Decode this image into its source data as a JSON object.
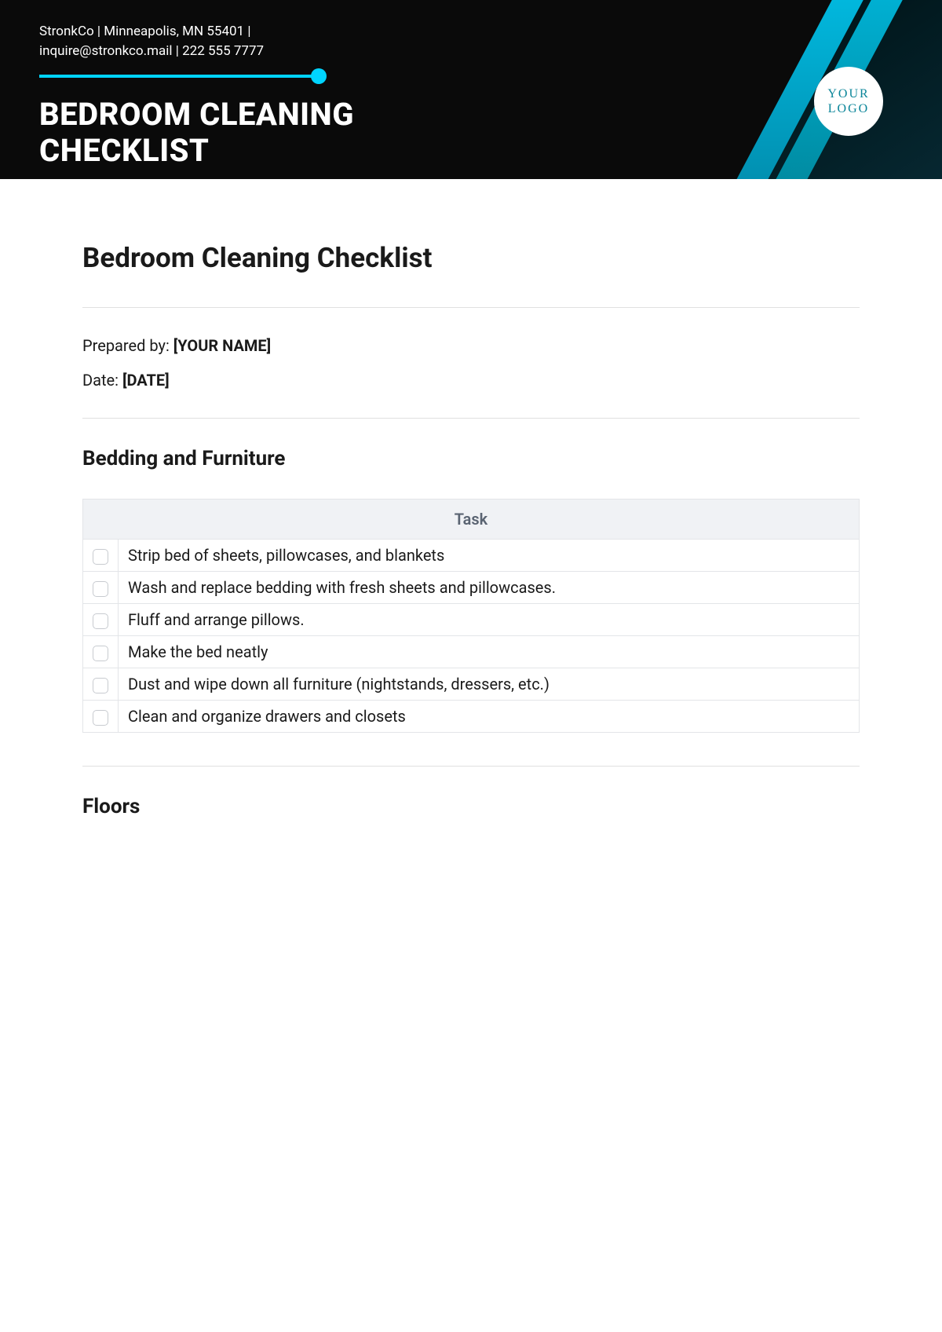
{
  "header": {
    "company_line1": "StronkCo | Minneapolis, MN 55401 |",
    "company_line2": "inquire@stronkco.mail | 222 555 7777",
    "title_line1": "BEDROOM CLEANING",
    "title_line2": "CHECKLIST",
    "logo_line1": "YOUR",
    "logo_line2": "LOGO"
  },
  "document": {
    "title": "Bedroom Cleaning Checklist",
    "prepared_by_label": "Prepared by: ",
    "prepared_by_value": "[YOUR NAME]",
    "date_label": "Date: ",
    "date_value": "[DATE]"
  },
  "sections": {
    "bedding": {
      "title": "Bedding and Furniture",
      "column_header": "Task",
      "tasks": [
        "Strip bed of sheets, pillowcases, and blankets",
        "Wash and replace bedding with fresh sheets and pillowcases.",
        "Fluff and arrange pillows.",
        "Make the bed neatly",
        "Dust and wipe down all furniture (nightstands, dressers, etc.)",
        "Clean and organize drawers and closets"
      ]
    },
    "floors": {
      "title": "Floors"
    }
  }
}
